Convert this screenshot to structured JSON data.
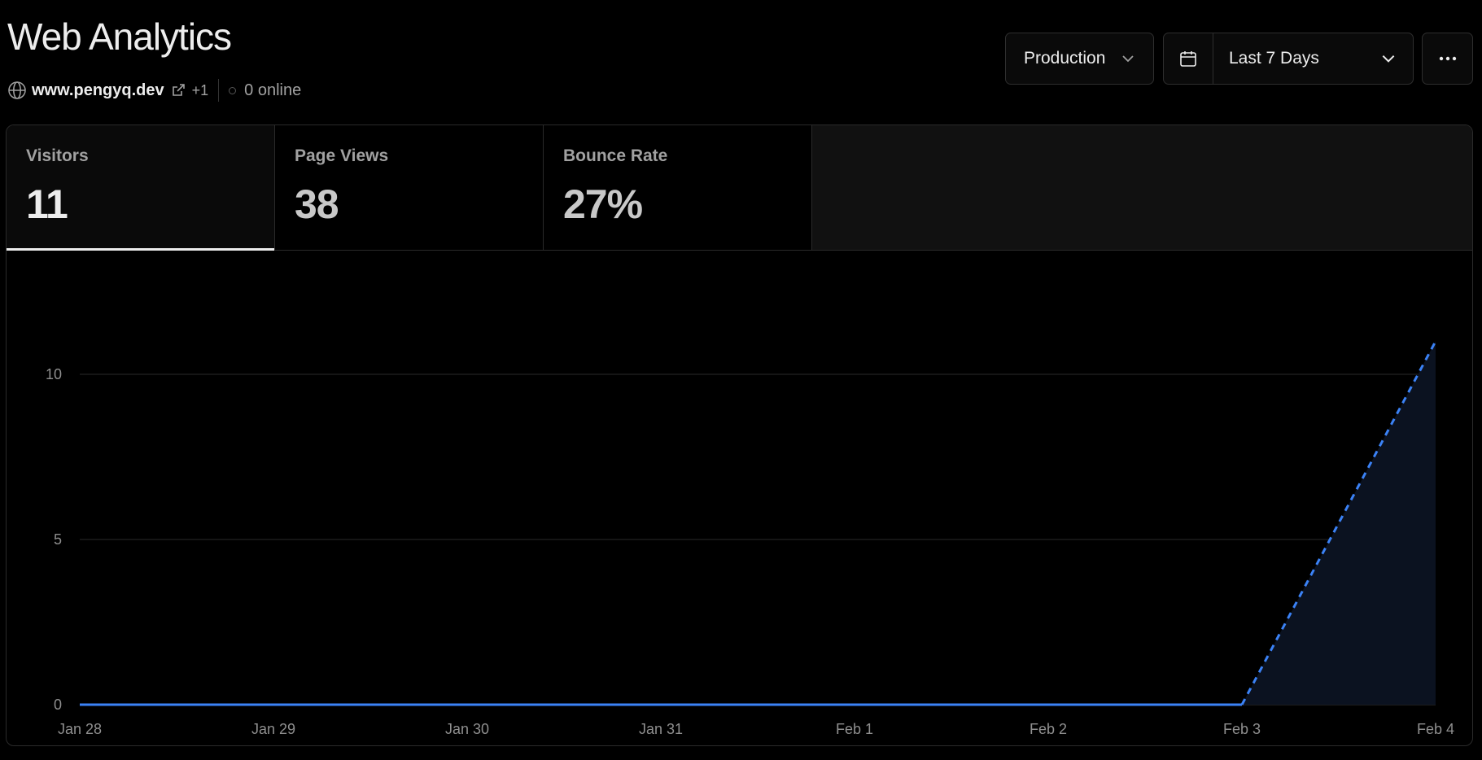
{
  "header": {
    "title": "Web Analytics",
    "domain": "www.pengyq.dev",
    "extra_domains": "+1",
    "online": "0 online"
  },
  "controls": {
    "environment": "Production",
    "date_range": "Last 7 Days"
  },
  "metrics": [
    {
      "label": "Visitors",
      "value": "11"
    },
    {
      "label": "Page Views",
      "value": "38"
    },
    {
      "label": "Bounce Rate",
      "value": "27%"
    }
  ],
  "icons": {
    "globe": "globe-icon",
    "external_link": "external-link-icon",
    "status_dot": "status-dot-icon",
    "chevron": "chevron-down-icon",
    "calendar": "calendar-icon",
    "more": "more-horizontal-icon"
  },
  "colors": {
    "background": "#000000",
    "accent": "#3b82f6",
    "area_fill": "#0b1220",
    "grid": "#2a2a2a"
  },
  "chart_data": {
    "type": "line",
    "categories": [
      "Jan 28",
      "Jan 29",
      "Jan 30",
      "Jan 31",
      "Feb 1",
      "Feb 2",
      "Feb 3",
      "Feb 4"
    ],
    "series": [
      {
        "values": [
          0,
          0,
          0,
          0,
          0,
          0,
          0,
          11
        ]
      }
    ],
    "yticks": [
      0,
      5,
      10
    ],
    "ylim": [
      0,
      11
    ],
    "grid": true,
    "last_segment_dashed": true
  }
}
